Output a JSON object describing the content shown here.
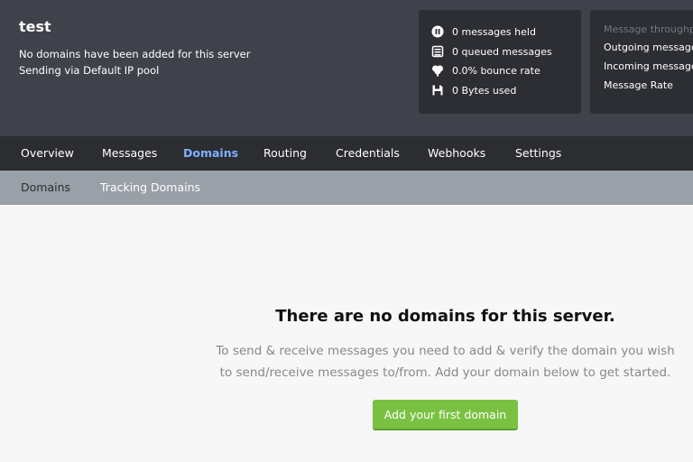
{
  "server": {
    "name": "test",
    "domains_note": "No domains have been added for this server",
    "ip_pool": "Sending via Default IP pool"
  },
  "stats": [
    {
      "icon": "pause-icon",
      "text": "0 messages held"
    },
    {
      "icon": "queue-icon",
      "text": "0 queued messages"
    },
    {
      "icon": "bounce-icon",
      "text": "0.0% bounce rate"
    },
    {
      "icon": "disk-icon",
      "text": "0 Bytes used"
    }
  ],
  "throughput": {
    "title": "Message throughput",
    "outgoing": "Outgoing messages",
    "incoming": "Incoming messages",
    "rate": "Message Rate"
  },
  "nav": {
    "items": [
      "Overview",
      "Messages",
      "Domains",
      "Routing",
      "Credentials",
      "Webhooks",
      "Settings"
    ],
    "active": "Domains"
  },
  "subnav": {
    "items": [
      "Domains",
      "Tracking Domains"
    ],
    "active": "Domains"
  },
  "empty": {
    "title": "There are no domains for this server.",
    "description": "To send & receive messages you need to add & verify the domain you wish to send/receive messages to/from. Add your domain below to get started.",
    "button": "Add your first domain"
  },
  "colors": {
    "header_bg": "#3f424a",
    "nav_bg": "#2b2d31",
    "subnav_bg": "#9aa0a8",
    "active_link": "#7fb0ff",
    "button_green": "#7ac143"
  }
}
